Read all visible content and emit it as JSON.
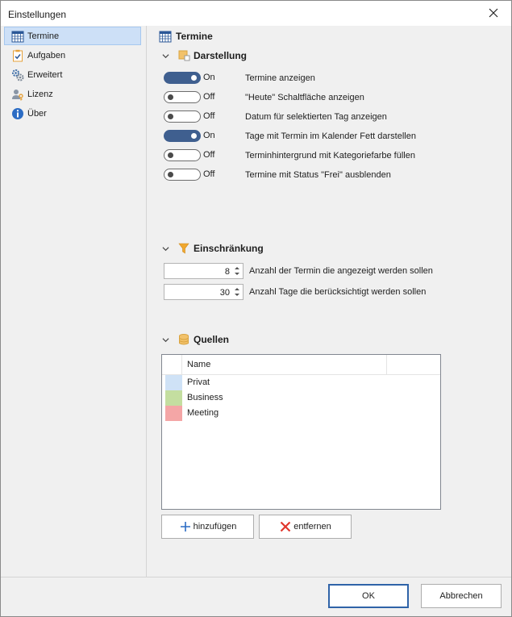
{
  "window": {
    "title": "Einstellungen"
  },
  "nav": {
    "items": [
      {
        "label": "Termine",
        "icon": "calendar-icon",
        "active": true
      },
      {
        "label": "Aufgaben",
        "icon": "clipboard-check-icon",
        "active": false
      },
      {
        "label": "Erweitert",
        "icon": "gears-icon",
        "active": false
      },
      {
        "label": "Lizenz",
        "icon": "user-key-icon",
        "active": false
      },
      {
        "label": "Über",
        "icon": "info-icon",
        "active": false
      }
    ]
  },
  "content": {
    "title": "Termine",
    "darstellung": {
      "header": "Darstellung",
      "toggles": [
        {
          "state": "On",
          "on": true,
          "label": "Termine anzeigen"
        },
        {
          "state": "Off",
          "on": false,
          "label": "\"Heute\" Schaltfläche anzeigen"
        },
        {
          "state": "Off",
          "on": false,
          "label": "Datum für selektierten Tag anzeigen"
        },
        {
          "state": "On",
          "on": true,
          "label": "Tage mit Termin im Kalender Fett darstellen"
        },
        {
          "state": "Off",
          "on": false,
          "label": "Terminhintergrund mit Kategoriefarbe füllen"
        },
        {
          "state": "Off",
          "on": false,
          "label": "Termine mit Status \"Frei\" ausblenden"
        }
      ]
    },
    "einschraenkung": {
      "header": "Einschränkung",
      "fields": [
        {
          "value": "8",
          "label": "Anzahl der Termin die angezeigt werden sollen"
        },
        {
          "value": "30",
          "label": "Anzahl Tage die berücksichtigt werden sollen"
        }
      ]
    },
    "quellen": {
      "header": "Quellen",
      "column": "Name",
      "rows": [
        {
          "name": "Privat",
          "color": "#cfe2f6"
        },
        {
          "name": "Business",
          "color": "#c4dea0"
        },
        {
          "name": "Meeting",
          "color": "#f4a6a6"
        }
      ],
      "add_label": "hinzufügen",
      "remove_label": "entfernen"
    }
  },
  "footer": {
    "ok_label": "OK",
    "cancel_label": "Abbrechen"
  },
  "colors": {
    "accent": "#3f5f8f",
    "selection": "#cde0f7",
    "ok_border": "#2f63a8"
  }
}
